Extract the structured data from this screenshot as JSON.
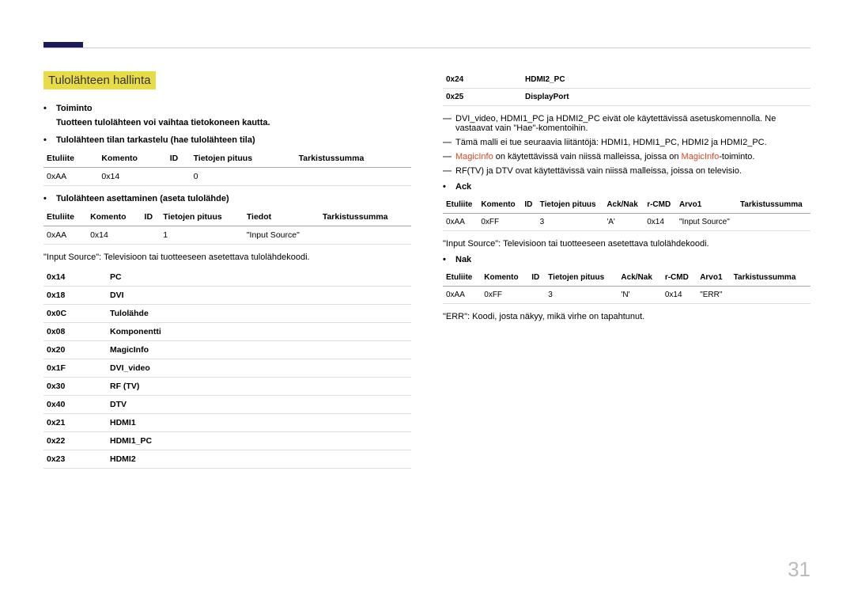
{
  "heading": "Tulolähteen hallinta",
  "left": {
    "bullets": {
      "b1": "Toiminto",
      "b1sub": "Tuotteen tulolähteen voi vaihtaa tietokoneen kautta.",
      "b2": "Tulolähteen tilan tarkastelu (hae tulolähteen tila)",
      "b3": "Tulolähteen asettaminen (aseta tulolähde)"
    },
    "tbl1": {
      "h1": "Etuliite",
      "h2": "Komento",
      "h3": "ID",
      "h4": "Tietojen pituus",
      "h5": "Tarkistussumma",
      "r1c1": "0xAA",
      "r1c2": "0x14",
      "r1c3": "",
      "r1c4": "0"
    },
    "tbl2": {
      "h1": "Etuliite",
      "h2": "Komento",
      "h3": "ID",
      "h4": "Tietojen pituus",
      "h5": "Tiedot",
      "h6": "Tarkistussumma",
      "r1c1": "0xAA",
      "r1c2": "0x14",
      "r1c3": "",
      "r1c4": "1",
      "r1c5": "\"Input Source\""
    },
    "note": "\"Input Source\": Televisioon tai tuotteeseen asetettava tulolähdekoodi.",
    "codes": [
      {
        "c": "0x14",
        "n": "PC"
      },
      {
        "c": "0x18",
        "n": "DVI"
      },
      {
        "c": "0x0C",
        "n": "Tulolähde"
      },
      {
        "c": "0x08",
        "n": "Komponentti"
      },
      {
        "c": "0x20",
        "n": "MagicInfo"
      },
      {
        "c": "0x1F",
        "n": "DVI_video"
      },
      {
        "c": "0x30",
        "n": "RF (TV)"
      },
      {
        "c": "0x40",
        "n": "DTV"
      },
      {
        "c": "0x21",
        "n": "HDMI1"
      },
      {
        "c": "0x22",
        "n": "HDMI1_PC"
      },
      {
        "c": "0x23",
        "n": "HDMI2"
      }
    ]
  },
  "right": {
    "top_codes": [
      {
        "c": "0x24",
        "n": "HDMI2_PC"
      },
      {
        "c": "0x25",
        "n": "DisplayPort"
      }
    ],
    "dashes": {
      "d1": "DVI_video, HDMI1_PC ja HDMI2_PC eivät ole käytettävissä asetuskomennolla. Ne vastaavat vain \"Hae\"-komentoihin.",
      "d2": "Tämä malli ei tue seuraavia liitäntöjä: HDMI1, HDMI1_PC, HDMI2 ja HDMI2_PC.",
      "d3a": "MagicInfo",
      "d3b": " on käytettävissä vain niissä malleissa, joissa on ",
      "d3c": "MagicInfo",
      "d3d": "-toiminto.",
      "d4": "RF(TV) ja DTV ovat käytettävissä vain niissä malleissa, joissa on televisio."
    },
    "ack_label": "Ack",
    "nak_label": "Nak",
    "ack_tbl": {
      "h1": "Etuliite",
      "h2": "Komento",
      "h3": "ID",
      "h4": "Tietojen pituus",
      "h5": "Ack/Nak",
      "h6": "r-CMD",
      "h7": "Arvo1",
      "h8": "Tarkistussumma",
      "r1c1": "0xAA",
      "r1c2": "0xFF",
      "r1c3": "",
      "r1c4": "3",
      "r1c5": "'A'",
      "r1c6": "0x14",
      "r1c7": "\"Input Source\""
    },
    "note2": "\"Input Source\": Televisioon tai tuotteeseen asetettava tulolähdekoodi.",
    "nak_tbl": {
      "h1": "Etuliite",
      "h2": "Komento",
      "h3": "ID",
      "h4": "Tietojen pituus",
      "h5": "Ack/Nak",
      "h6": "r-CMD",
      "h7": "Arvo1",
      "h8": "Tarkistussumma",
      "r1c1": "0xAA",
      "r1c2": "0xFF",
      "r1c3": "",
      "r1c4": "3",
      "r1c5": "'N'",
      "r1c6": "0x14",
      "r1c7": "\"ERR\""
    },
    "err_note": "\"ERR\": Koodi, josta näkyy, mikä virhe on tapahtunut."
  },
  "page_num": "31"
}
